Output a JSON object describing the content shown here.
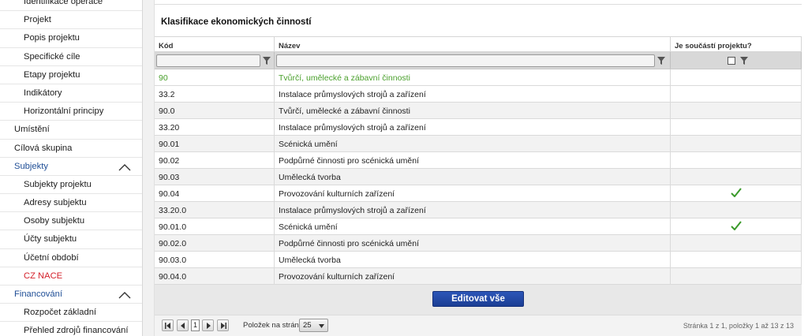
{
  "sidebar": {
    "items": [
      {
        "label": "Identifikace operace",
        "level": "sub",
        "color": "normal"
      },
      {
        "label": "Projekt",
        "level": "sub",
        "color": "normal"
      },
      {
        "label": "Popis projektu",
        "level": "sub",
        "color": "normal"
      },
      {
        "label": "Specifické cíle",
        "level": "sub",
        "color": "normal"
      },
      {
        "label": "Etapy projektu",
        "level": "sub",
        "color": "normal"
      },
      {
        "label": "Indikátory",
        "level": "sub",
        "color": "normal"
      },
      {
        "label": "Horizontální principy",
        "level": "sub",
        "color": "normal"
      },
      {
        "label": "Umístění",
        "level": "top",
        "color": "normal"
      },
      {
        "label": "Cílová skupina",
        "level": "top",
        "color": "normal"
      },
      {
        "label": "Subjekty",
        "level": "top",
        "color": "blue",
        "expanded": true
      },
      {
        "label": "Subjekty projektu",
        "level": "sub",
        "color": "normal"
      },
      {
        "label": "Adresy subjektu",
        "level": "sub",
        "color": "normal"
      },
      {
        "label": "Osoby subjektu",
        "level": "sub",
        "color": "normal"
      },
      {
        "label": "Účty subjektu",
        "level": "sub",
        "color": "normal"
      },
      {
        "label": "Účetní období",
        "level": "sub",
        "color": "normal"
      },
      {
        "label": "CZ NACE",
        "level": "sub",
        "color": "red",
        "active": true
      },
      {
        "label": "Financování",
        "level": "top",
        "color": "blue",
        "expanded": true
      },
      {
        "label": "Rozpočet základní",
        "level": "sub",
        "color": "normal"
      },
      {
        "label": "Přehled zdrojů financování",
        "level": "sub",
        "color": "normal"
      }
    ]
  },
  "panel": {
    "title": "Klasifikace ekonomických činností"
  },
  "grid": {
    "columns": [
      "Kód",
      "Název",
      "Je součástí projektu?"
    ],
    "rows": [
      {
        "kod": "90",
        "nazev": "Tvůrčí, umělecké a zábavní činnosti",
        "checked": false,
        "selected": true
      },
      {
        "kod": "33.2",
        "nazev": "Instalace průmyslových strojů a zařízení",
        "checked": false
      },
      {
        "kod": "90.0",
        "nazev": "Tvůrčí, umělecké a zábavní činnosti",
        "checked": false
      },
      {
        "kod": "33.20",
        "nazev": "Instalace průmyslových strojů a zařízení",
        "checked": false
      },
      {
        "kod": "90.01",
        "nazev": "Scénická umění",
        "checked": false
      },
      {
        "kod": "90.02",
        "nazev": "Podpůrné činnosti pro scénická umění",
        "checked": false
      },
      {
        "kod": "90.03",
        "nazev": "Umělecká tvorba",
        "checked": false
      },
      {
        "kod": "90.04",
        "nazev": "Provozování kulturních zařízení",
        "checked": true
      },
      {
        "kod": "33.20.0",
        "nazev": "Instalace průmyslových strojů a zařízení",
        "checked": false
      },
      {
        "kod": "90.01.0",
        "nazev": "Scénická umění",
        "checked": true
      },
      {
        "kod": "90.02.0",
        "nazev": "Podpůrné činnosti pro scénická umění",
        "checked": false
      },
      {
        "kod": "90.03.0",
        "nazev": "Umělecká tvorba",
        "checked": false
      },
      {
        "kod": "90.04.0",
        "nazev": "Provozování kulturních zařízení",
        "checked": false
      }
    ]
  },
  "actions": {
    "edit_all_label": "Editovat vše"
  },
  "pager": {
    "current_page": "1",
    "page_size_label": "Položek na stránku",
    "page_size_value": "25",
    "info": "Stránka 1 z 1, položky 1 až 13 z 13"
  },
  "colors": {
    "accent_blue": "#1f4e96",
    "active_red": "#d4202a",
    "selected_green": "#4aa02c",
    "check_green": "#3a9a2a",
    "button_blue": "#1b3e94"
  },
  "icons": {
    "filter": "filter-icon",
    "chevron_up": "chevron-up-icon",
    "check": "checkmark-icon",
    "first": "first-page-icon",
    "prev": "prev-page-icon",
    "next": "next-page-icon",
    "last": "last-page-icon",
    "dropdown": "chevron-down-icon"
  }
}
